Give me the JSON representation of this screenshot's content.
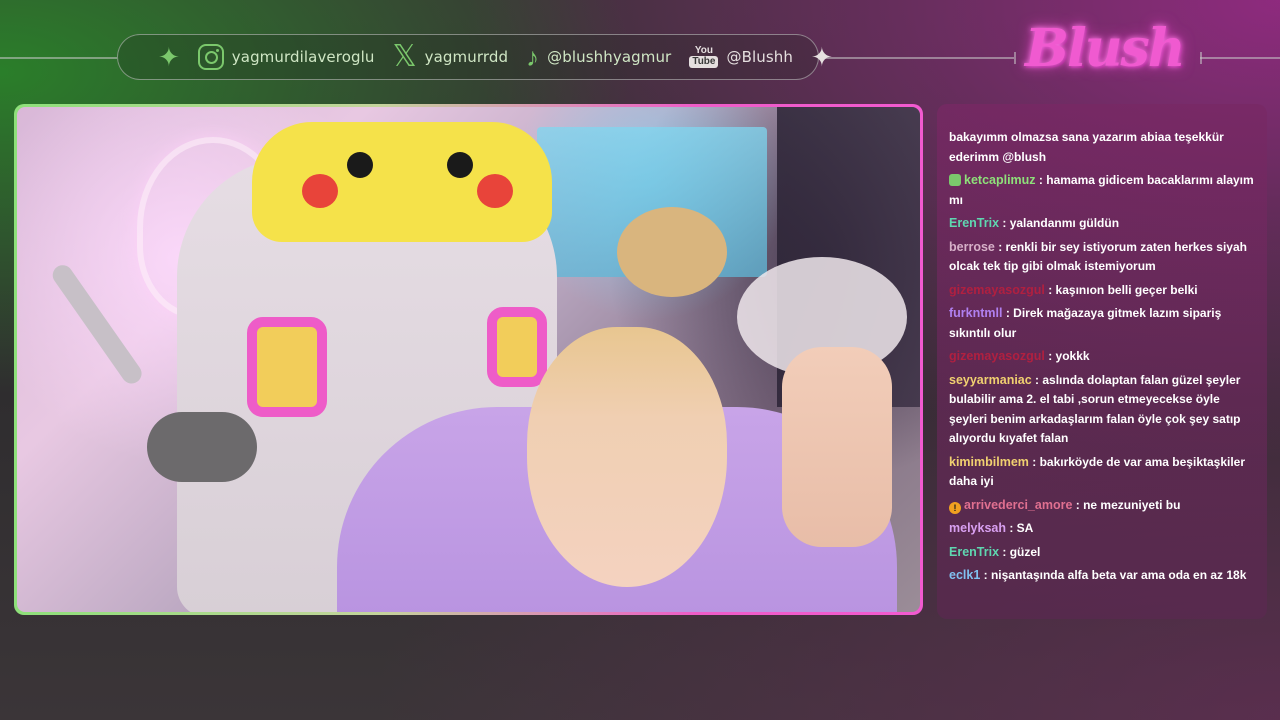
{
  "social": {
    "instagram": "yagmurdilaveroglu",
    "x": "yagmurrdd",
    "tiktok": "@blushhyagmur",
    "youtube_icon_top": "You",
    "youtube_icon_bottom": "Tube",
    "youtube": "@Blushh"
  },
  "logo": {
    "text": "Blush",
    "color": "#f05ad0"
  },
  "icons": {
    "sparkle_left": "sparkle-icon",
    "instagram": "instagram-icon",
    "x": "x-icon",
    "tiktok": "tiktok-icon",
    "youtube": "youtube-icon",
    "sparkle_right": "sparkle-icon"
  },
  "colors": {
    "accent_green": "#7bc86c",
    "accent_pink": "#f05ad0"
  },
  "chat": {
    "messages": [
      {
        "user": "",
        "color": "#ffffff",
        "badge": "",
        "text": "bakayımm olmazsa sana yazarım abiaa teşekkür ederimm @blush"
      },
      {
        "user": "ketcaplimuz",
        "color": "#8ee07a",
        "badge": "green",
        "text": ": hamama gidicem bacaklarımı alayım mı"
      },
      {
        "user": "ErenTrix",
        "color": "#5fd6b0",
        "badge": "",
        "text": ": yalandanmı güldün"
      },
      {
        "user": "berrose",
        "color": "#d6b0c8",
        "badge": "",
        "text": ": renkli bir sey istiyorum zaten herkes siyah olcak tek tip gibi olmak istemiyorum"
      },
      {
        "user": "gizemayasozgul",
        "color": "#b02040",
        "badge": "",
        "text": ": kaşınıon belli geçer belki"
      },
      {
        "user": "furkntmll",
        "color": "#b080f0",
        "badge": "",
        "text": ": Direk mağazaya gitmek lazım sipariş sıkıntılı olur"
      },
      {
        "user": "gizemayasozgul",
        "color": "#b02040",
        "badge": "",
        "text": ": yokkk"
      },
      {
        "user": "seyyarmaniac",
        "color": "#f0d070",
        "badge": "",
        "text": ": aslında dolaptan falan güzel şeyler bulabilir ama 2. el tabi ,sorun etmeyeceksе öyle şeyleri benim arkadaşlarım falan öyle çok şey satıp alıyordu kıyafet falan"
      },
      {
        "user": "kimimbilmem",
        "color": "#f0d070",
        "badge": "",
        "text": ": bakırköyde de var ama beşiktaşkiler daha iyi"
      },
      {
        "user": "arrivederci_amore",
        "color": "#e07090",
        "badge": "orange",
        "text": ": ne mezuniyeti bu"
      },
      {
        "user": "melyksah",
        "color": "#d8a0f0",
        "badge": "",
        "text": ": SA"
      },
      {
        "user": "ErenTrix",
        "color": "#5fd6b0",
        "badge": "",
        "text": ": güzel"
      },
      {
        "user": "eclk1",
        "color": "#80c0f0",
        "badge": "",
        "text": ": nişantaşında alfa beta var ama oda en az 18k"
      }
    ]
  }
}
